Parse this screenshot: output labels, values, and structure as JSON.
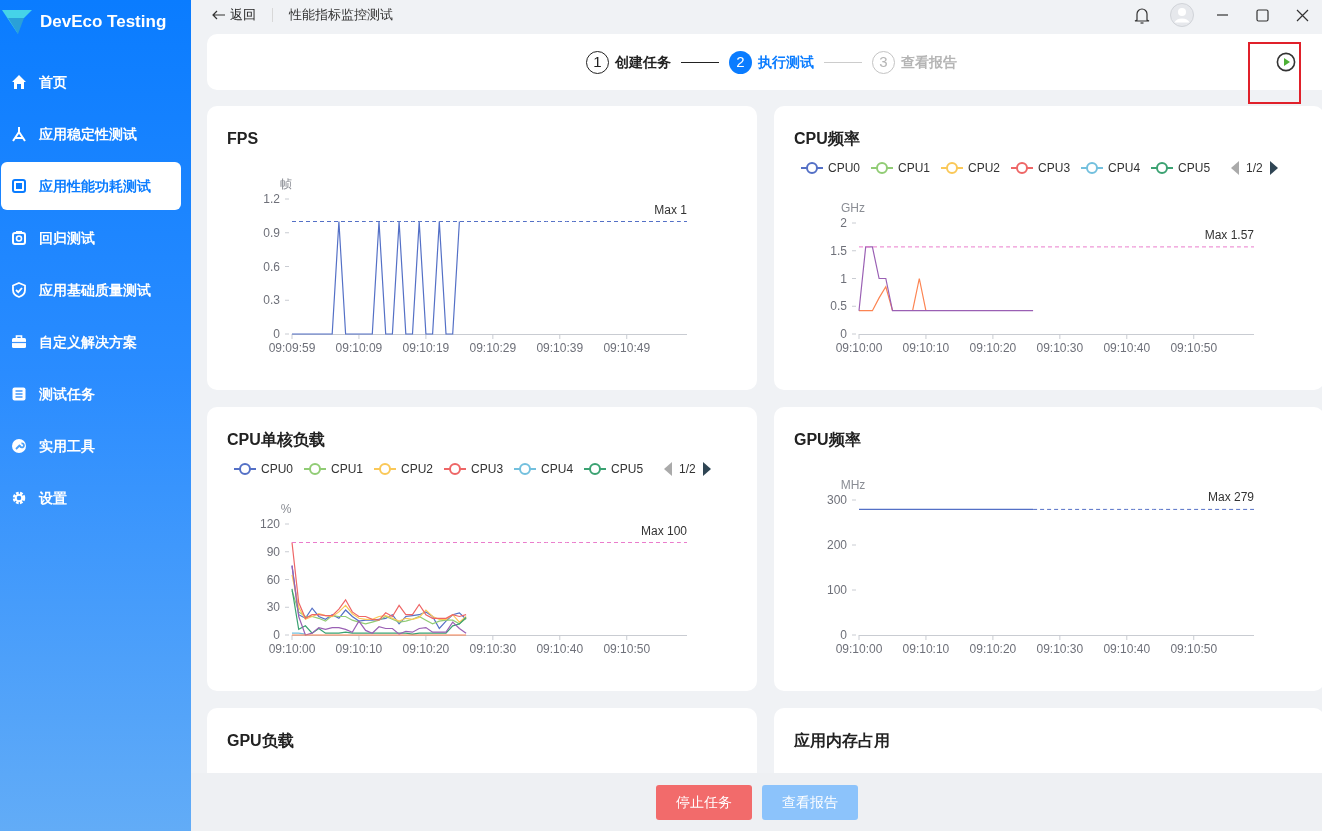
{
  "app": {
    "name": "DevEco Testing"
  },
  "sidebar": {
    "items": [
      {
        "label": "首页",
        "selected": false
      },
      {
        "label": "应用稳定性测试",
        "selected": false
      },
      {
        "label": "应用性能功耗测试",
        "selected": true
      },
      {
        "label": "回归测试",
        "selected": false
      },
      {
        "label": "应用基础质量测试",
        "selected": false
      },
      {
        "label": "自定义解决方案",
        "selected": false
      },
      {
        "label": "测试任务",
        "selected": false
      },
      {
        "label": "实用工具",
        "selected": false
      },
      {
        "label": "设置",
        "selected": false
      }
    ]
  },
  "header": {
    "back": "返回",
    "title": "性能指标监控测试"
  },
  "steps": [
    {
      "number": "1",
      "label": "创建任务",
      "done": true,
      "selected": false
    },
    {
      "number": "2",
      "label": "执行测试",
      "done": false,
      "selected": true
    },
    {
      "number": "3",
      "label": "查看报告",
      "done": false,
      "selected": false
    }
  ],
  "run_button": {
    "highlighted": true
  },
  "cards": [
    {
      "title": "FPS",
      "chart_data": {
        "type": "line",
        "ylabel": "帧",
        "categories": [
          "09:09:59",
          null,
          null,
          null,
          null,
          null,
          null,
          null,
          null,
          null,
          "09:10:09",
          null,
          null,
          null,
          null,
          null,
          null,
          null,
          null,
          null,
          "09:10:19",
          null,
          null,
          null,
          null,
          null,
          null,
          null,
          null,
          null,
          "09:10:29",
          null,
          null,
          null,
          null,
          null,
          null,
          null,
          null,
          null,
          "09:10:39",
          null,
          null,
          null,
          null,
          null,
          null,
          null,
          null,
          null,
          "09:10:49",
          null,
          null,
          null,
          null,
          null,
          null,
          null,
          null,
          null
        ],
        "ylim": [
          0,
          1.2
        ],
        "yticks": [
          0,
          0.3,
          0.6,
          0.9,
          1.2
        ],
        "series": [
          {
            "color": "#5470c6",
            "values": [
              0,
              0,
              0,
              0,
              0,
              0,
              0,
              1,
              0,
              0,
              0,
              0,
              0,
              1,
              0,
              0,
              1,
              0,
              0,
              1,
              0,
              0,
              1,
              0,
              0,
              1,
              null,
              null,
              null,
              null,
              null,
              null,
              null,
              null,
              null,
              null,
              null,
              null,
              null,
              null,
              null,
              null,
              null,
              null,
              null,
              null,
              null,
              null,
              null,
              null,
              null,
              null,
              null,
              null,
              null,
              null,
              null,
              null,
              null,
              null
            ]
          },
          {
            "name": "Max 1",
            "line_style": "dashed",
            "color": "#5470c6",
            "values": [
              1,
              1,
              1,
              1,
              1,
              1,
              1,
              1,
              1,
              1,
              1,
              1,
              1,
              1,
              1,
              1,
              1,
              1,
              1,
              1,
              1,
              1,
              1,
              1,
              1,
              1,
              1,
              1,
              1,
              1,
              1,
              1,
              1,
              1,
              1,
              1,
              1,
              1,
              1,
              1,
              1,
              1,
              1,
              1,
              1,
              1,
              1,
              1,
              1,
              1,
              1,
              1,
              1,
              1,
              1,
              1,
              1,
              1,
              1,
              1
            ]
          }
        ]
      }
    },
    {
      "title": "CPU频率",
      "legend": {
        "page": "1/2",
        "items": [
          {
            "name": "CPU0",
            "color": "#5470c6"
          },
          {
            "name": "CPU1",
            "color": "#91cc75"
          },
          {
            "name": "CPU2",
            "color": "#fac858"
          },
          {
            "name": "CPU3",
            "color": "#ee6666"
          },
          {
            "name": "CPU4",
            "color": "#73c0de"
          },
          {
            "name": "CPU5",
            "color": "#3ba272"
          }
        ]
      },
      "chart_data": {
        "type": "line",
        "ylabel": "GHz",
        "categories": [
          "09:10:00",
          null,
          null,
          null,
          null,
          null,
          null,
          null,
          null,
          null,
          "09:10:10",
          null,
          null,
          null,
          null,
          null,
          null,
          null,
          null,
          null,
          "09:10:20",
          null,
          null,
          null,
          null,
          null,
          null,
          null,
          null,
          null,
          "09:10:30",
          null,
          null,
          null,
          null,
          null,
          null,
          null,
          null,
          null,
          "09:10:40",
          null,
          null,
          null,
          null,
          null,
          null,
          null,
          null,
          null,
          "09:10:50",
          null,
          null,
          null,
          null,
          null,
          null,
          null,
          null,
          null
        ],
        "ylim": [
          0,
          2
        ],
        "yticks": [
          0,
          0.5,
          1,
          1.5,
          2
        ],
        "series": [
          {
            "color": "#fc8452",
            "values": [
              0.42,
              0.42,
              0.42,
              0.65,
              0.85,
              0.42,
              null,
              null,
              0.42,
              1,
              0.42,
              null,
              null,
              null,
              null,
              null,
              null,
              null,
              null,
              null,
              null,
              null,
              null,
              null,
              null,
              null,
              null,
              null,
              null,
              null,
              null,
              null,
              null,
              null,
              null,
              null,
              null,
              null,
              null,
              null,
              null,
              null,
              null,
              null,
              null,
              null,
              null,
              null,
              null,
              null,
              null,
              null,
              null,
              null,
              null,
              null,
              null,
              null,
              null,
              null
            ]
          },
          {
            "color": "#9a60b4",
            "values": [
              0.42,
              1.57,
              1.57,
              1,
              1,
              0.42,
              0.42,
              0.42,
              0.42,
              0.42,
              0.42,
              0.42,
              0.42,
              0.42,
              0.42,
              0.42,
              0.42,
              0.42,
              0.42,
              0.42,
              0.42,
              0.42,
              0.42,
              0.42,
              0.42,
              0.42,
              0.42,
              null,
              null,
              null,
              null,
              null,
              null,
              null,
              null,
              null,
              null,
              null,
              null,
              null,
              null,
              null,
              null,
              null,
              null,
              null,
              null,
              null,
              null,
              null,
              null,
              null,
              null,
              null,
              null,
              null,
              null,
              null,
              null,
              null
            ]
          },
          {
            "name": "Max 1.57",
            "line_style": "dashed",
            "color": "#ea7ccc",
            "values": [
              1.57,
              1.57,
              1.57,
              1.57,
              1.57,
              1.57,
              1.57,
              1.57,
              1.57,
              1.57,
              1.57,
              1.57,
              1.57,
              1.57,
              1.57,
              1.57,
              1.57,
              1.57,
              1.57,
              1.57,
              1.57,
              1.57,
              1.57,
              1.57,
              1.57,
              1.57,
              1.57,
              1.57,
              1.57,
              1.57,
              1.57,
              1.57,
              1.57,
              1.57,
              1.57,
              1.57,
              1.57,
              1.57,
              1.57,
              1.57,
              1.57,
              1.57,
              1.57,
              1.57,
              1.57,
              1.57,
              1.57,
              1.57,
              1.57,
              1.57,
              1.57,
              1.57,
              1.57,
              1.57,
              1.57,
              1.57,
              1.57,
              1.57,
              1.57,
              1.57
            ]
          }
        ]
      }
    },
    {
      "title": "CPU单核负载",
      "legend": {
        "page": "1/2",
        "items": [
          {
            "name": "CPU0",
            "color": "#5470c6"
          },
          {
            "name": "CPU1",
            "color": "#91cc75"
          },
          {
            "name": "CPU2",
            "color": "#fac858"
          },
          {
            "name": "CPU3",
            "color": "#ee6666"
          },
          {
            "name": "CPU4",
            "color": "#73c0de"
          },
          {
            "name": "CPU5",
            "color": "#3ba272"
          }
        ]
      },
      "chart_data": {
        "type": "line",
        "ylabel": "%",
        "categories": [
          "09:10:00",
          null,
          null,
          null,
          null,
          null,
          null,
          null,
          null,
          null,
          "09:10:10",
          null,
          null,
          null,
          null,
          null,
          null,
          null,
          null,
          null,
          "09:10:20",
          null,
          null,
          null,
          null,
          null,
          null,
          null,
          null,
          null,
          "09:10:30",
          null,
          null,
          null,
          null,
          null,
          null,
          null,
          null,
          null,
          "09:10:40",
          null,
          null,
          null,
          null,
          null,
          null,
          null,
          null,
          null,
          "09:10:50",
          null,
          null,
          null,
          null,
          null,
          null,
          null,
          null,
          null
        ],
        "ylim": [
          0,
          120
        ],
        "yticks": [
          0,
          30,
          60,
          90,
          120
        ],
        "series": [
          {
            "color": "#73c0de",
            "values": [
              2,
              2,
              1,
              null,
              null,
              null,
              null,
              null,
              null,
              null,
              null,
              null,
              null,
              null,
              null,
              null,
              null,
              null,
              null,
              null,
              null,
              null,
              null,
              null,
              null,
              null,
              null,
              null,
              null,
              null,
              null,
              null,
              null,
              null,
              null,
              null,
              null,
              null,
              null,
              null,
              null,
              null,
              null,
              null,
              null,
              null,
              null,
              null,
              null,
              null,
              null,
              null,
              null,
              null,
              null,
              null,
              null,
              null,
              null,
              null
            ]
          },
          {
            "color": "#5470c6",
            "values": [
              75,
              22,
              18,
              29,
              20,
              17,
              22,
              18,
              27,
              20,
              15,
              16,
              16,
              17,
              18,
              22,
              12,
              20,
              21,
              22,
              25,
              20,
              7,
              15,
              22,
              24,
              17,
              null,
              null,
              null,
              null,
              null,
              null,
              null,
              null,
              null,
              null,
              null,
              null,
              null,
              null,
              null,
              null,
              null,
              null,
              null,
              null,
              null,
              null,
              null,
              null,
              null,
              null,
              null,
              null,
              null,
              null,
              null,
              null,
              null
            ]
          },
          {
            "color": "#91cc75",
            "values": [
              48,
              25,
              20,
              20,
              18,
              15,
              21,
              20,
              20,
              16,
              14,
              12,
              14,
              16,
              20,
              17,
              14,
              15,
              17,
              20,
              16,
              12,
              15,
              16,
              16,
              12,
              18,
              null,
              null,
              null,
              null,
              null,
              null,
              null,
              null,
              null,
              null,
              null,
              null,
              null,
              null,
              null,
              null,
              null,
              null,
              null,
              null,
              null,
              null,
              null,
              null,
              null,
              null,
              null,
              null,
              null,
              null,
              null,
              null,
              null
            ]
          },
          {
            "color": "#fac858",
            "values": [
              65,
              30,
              17,
              20,
              23,
              21,
              20,
              25,
              32,
              23,
              18,
              17,
              17,
              20,
              21,
              18,
              15,
              18,
              17,
              19,
              27,
              20,
              17,
              17,
              22,
              14,
              20,
              null,
              null,
              null,
              null,
              null,
              null,
              null,
              null,
              null,
              null,
              null,
              null,
              null,
              null,
              null,
              null,
              null,
              null,
              null,
              null,
              null,
              null,
              null,
              null,
              null,
              null,
              null,
              null,
              null,
              null,
              null,
              null,
              null
            ]
          },
          {
            "color": "#ee6666",
            "values": [
              100,
              35,
              18,
              22,
              22,
              21,
              21,
              28,
              38,
              25,
              20,
              20,
              17,
              16,
              24,
              20,
              32,
              22,
              22,
              33,
              22,
              18,
              18,
              18,
              22,
              20,
              22,
              null,
              null,
              null,
              null,
              null,
              null,
              null,
              null,
              null,
              null,
              null,
              null,
              null,
              null,
              null,
              null,
              null,
              null,
              null,
              null,
              null,
              null,
              null,
              null,
              null,
              null,
              null,
              null,
              null,
              null,
              null,
              null,
              null
            ]
          },
          {
            "color": "#3ba272",
            "values": [
              50,
              6,
              10,
              2,
              7,
              2,
              2,
              2,
              3,
              2,
              2,
              2,
              2,
              2,
              2,
              2,
              2,
              2,
              1,
              2,
              2,
              2,
              2,
              2,
              10,
              12,
              19,
              null,
              null,
              null,
              null,
              null,
              null,
              null,
              null,
              null,
              null,
              null,
              null,
              null,
              null,
              null,
              null,
              null,
              null,
              null,
              null,
              null,
              null,
              null,
              null,
              null,
              null,
              null,
              null,
              null,
              null,
              null,
              null,
              null
            ]
          },
          {
            "color": "#9a60b4",
            "values": [
              75,
              20,
              0,
              2,
              8,
              6,
              8,
              8,
              6,
              3,
              15,
              5,
              2,
              9,
              7,
              7,
              1,
              4,
              3,
              7,
              8,
              3,
              3,
              3,
              14,
              7,
              2,
              null,
              null,
              null,
              null,
              null,
              null,
              null,
              null,
              null,
              null,
              null,
              null,
              null,
              null,
              null,
              null,
              null,
              null,
              null,
              null,
              null,
              null,
              null,
              null,
              null,
              null,
              null,
              null,
              null,
              null,
              null,
              null,
              null
            ]
          },
          {
            "color": "#fc8452",
            "values": [
              0,
              0,
              0,
              0,
              0,
              0,
              0,
              0,
              0,
              0,
              0,
              0,
              0,
              0,
              0,
              0,
              0,
              0,
              0,
              0,
              0,
              0,
              0,
              0,
              0,
              0,
              0,
              null,
              null,
              null,
              null,
              null,
              null,
              null,
              null,
              null,
              null,
              null,
              null,
              null,
              null,
              null,
              null,
              null,
              null,
              null,
              null,
              null,
              null,
              null,
              null,
              null,
              null,
              null,
              null,
              null,
              null,
              null,
              null,
              null
            ]
          },
          {
            "name": "Max 100",
            "line_style": "dashed",
            "color": "#ea7ccc",
            "values": [
              100,
              100,
              100,
              100,
              100,
              100,
              100,
              100,
              100,
              100,
              100,
              100,
              100,
              100,
              100,
              100,
              100,
              100,
              100,
              100,
              100,
              100,
              100,
              100,
              100,
              100,
              100,
              100,
              100,
              100,
              100,
              100,
              100,
              100,
              100,
              100,
              100,
              100,
              100,
              100,
              100,
              100,
              100,
              100,
              100,
              100,
              100,
              100,
              100,
              100,
              100,
              100,
              100,
              100,
              100,
              100,
              100,
              100,
              100,
              100
            ]
          }
        ]
      }
    },
    {
      "title": "GPU频率",
      "chart_data": {
        "type": "line",
        "ylabel": "MHz",
        "categories": [
          "09:10:00",
          null,
          null,
          null,
          null,
          null,
          null,
          null,
          null,
          null,
          "09:10:10",
          null,
          null,
          null,
          null,
          null,
          null,
          null,
          null,
          null,
          "09:10:20",
          null,
          null,
          null,
          null,
          null,
          null,
          null,
          null,
          null,
          "09:10:30",
          null,
          null,
          null,
          null,
          null,
          null,
          null,
          null,
          null,
          "09:10:40",
          null,
          null,
          null,
          null,
          null,
          null,
          null,
          null,
          null,
          "09:10:50",
          null,
          null,
          null,
          null,
          null,
          null,
          null,
          null,
          null
        ],
        "ylim": [
          0,
          300
        ],
        "yticks": [
          0,
          100,
          200,
          300
        ],
        "series": [
          {
            "color": "#5470c6",
            "values": [
              279,
              279,
              279,
              279,
              279,
              279,
              279,
              279,
              279,
              279,
              279,
              279,
              279,
              279,
              279,
              279,
              279,
              279,
              279,
              279,
              279,
              279,
              279,
              279,
              279,
              279,
              279,
              null,
              null,
              null,
              null,
              null,
              null,
              null,
              null,
              null,
              null,
              null,
              null,
              null,
              null,
              null,
              null,
              null,
              null,
              null,
              null,
              null,
              null,
              null,
              null,
              null,
              null,
              null,
              null,
              null,
              null,
              null,
              null,
              null
            ]
          },
          {
            "name": "Max 279",
            "line_style": "dashed",
            "color": "#5470c6",
            "values": [
              null,
              null,
              null,
              null,
              null,
              null,
              null,
              null,
              null,
              null,
              null,
              null,
              null,
              null,
              null,
              null,
              null,
              null,
              null,
              null,
              null,
              null,
              null,
              null,
              null,
              null,
              279,
              279,
              279,
              279,
              279,
              279,
              279,
              279,
              279,
              279,
              279,
              279,
              279,
              279,
              279,
              279,
              279,
              279,
              279,
              279,
              279,
              279,
              279,
              279,
              279,
              279,
              279,
              279,
              279,
              279,
              279,
              279,
              279,
              279
            ]
          }
        ]
      }
    },
    {
      "title": "GPU负载"
    },
    {
      "title": "应用内存占用"
    }
  ],
  "footer": {
    "buttons": [
      {
        "label": "停止任务",
        "kind": "danger",
        "disabled": false
      },
      {
        "label": "查看报告",
        "kind": "primary",
        "disabled": true
      }
    ]
  }
}
